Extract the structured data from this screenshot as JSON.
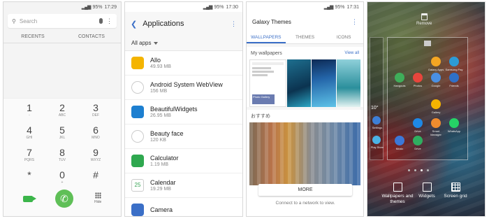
{
  "status": {
    "p1": {
      "battery": "95%",
      "time": "17:29"
    },
    "p2": {
      "battery": "95%",
      "time": "17:30"
    },
    "p3": {
      "battery": "95%",
      "time": "17:31"
    }
  },
  "dialer": {
    "search_placeholder": "Search",
    "tabs": [
      "RECENTS",
      "CONTACTS"
    ],
    "keys": [
      [
        "1",
        "-"
      ],
      [
        "2",
        "ABC"
      ],
      [
        "3",
        "DEF"
      ],
      [
        "4",
        "GHI"
      ],
      [
        "5",
        "JKL"
      ],
      [
        "6",
        "MNO"
      ],
      [
        "7",
        "PQRS"
      ],
      [
        "8",
        "TUV"
      ],
      [
        "9",
        "WXYZ"
      ],
      [
        "*",
        ""
      ],
      [
        "0",
        "+"
      ],
      [
        "#",
        ""
      ]
    ],
    "hide_label": "Hide"
  },
  "apps": {
    "title": "Applications",
    "filter": "All apps",
    "items": [
      {
        "name": "Allo",
        "size": "49.93 MB"
      },
      {
        "name": "Android System WebView",
        "size": "156 MB"
      },
      {
        "name": "BeautifulWidgets",
        "size": "26.95 MB"
      },
      {
        "name": "Beauty face",
        "size": "120 KB"
      },
      {
        "name": "Calculator",
        "size": "1.19 MB"
      },
      {
        "name": "Calendar",
        "size": "19.29 MB"
      },
      {
        "name": "Camera",
        "size": ""
      }
    ],
    "colors": [
      "#f4b400",
      "#ffffff",
      "#1d7fd0",
      "#ffffff",
      "#2fa84f",
      "#ffffff",
      "#3b6fc7"
    ],
    "calendar_day": "25"
  },
  "themes": {
    "title": "Galaxy Themes",
    "tabs": [
      "WALLPAPERS",
      "THEMES",
      "ICONS"
    ],
    "my_wallpapers": "My wallpapers",
    "view_all": "View all",
    "recommended": "おすすめ",
    "more": "MORE",
    "connect": "Connect to a network to view.",
    "sample": "Photo Gallery"
  },
  "home": {
    "remove": "Remove",
    "temp": "10°",
    "left_apps": [
      "Settings",
      "Play Store"
    ],
    "apps": [
      "Hangouts",
      "Photos",
      "Google",
      "Friends",
      "Galaxy Apps",
      "Samsung Pay",
      "Music",
      "Drive",
      "Gallery",
      "WhatsApp",
      "Smart Manager",
      "Drive"
    ],
    "buttons": [
      "Wallpapers and themes",
      "Widgets",
      "Screen grid"
    ]
  }
}
